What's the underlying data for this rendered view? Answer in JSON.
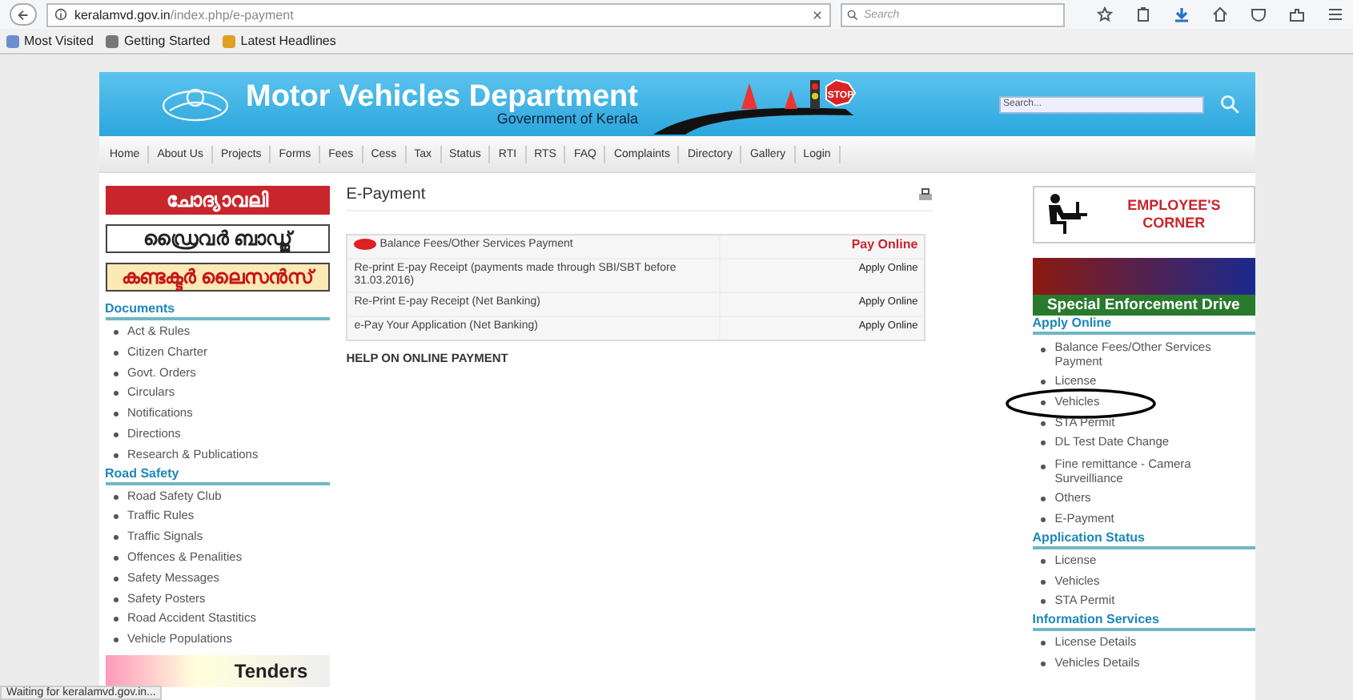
{
  "browser": {
    "url_domain": "keralamvd.gov.in",
    "url_path": "/index.php/e-payment",
    "search_placeholder": "Search",
    "bookmarks": [
      {
        "label": "Most Visited",
        "kind": "visited"
      },
      {
        "label": "Getting Started",
        "kind": "firefox"
      },
      {
        "label": "Latest Headlines",
        "kind": "feed"
      }
    ]
  },
  "header": {
    "title": "Motor Vehicles Department",
    "subtitle": "Government of Kerala",
    "sign": "STOP",
    "search_placeholder": "Search..."
  },
  "nav": [
    {
      "label": "Home"
    },
    {
      "label": "About Us"
    },
    {
      "label": "Projects"
    },
    {
      "label": "Forms"
    },
    {
      "label": "Fees"
    },
    {
      "label": "Cess"
    },
    {
      "label": "Tax"
    },
    {
      "label": "Status"
    },
    {
      "label": "RTI"
    },
    {
      "label": "RTS"
    },
    {
      "label": "FAQ"
    },
    {
      "label": "Complaints"
    },
    {
      "label": "Directory"
    },
    {
      "label": "Gallery"
    },
    {
      "label": "Login"
    }
  ],
  "left": {
    "banners": [
      {
        "text": "ചോദ്യാവലി",
        "kind": "red"
      },
      {
        "text": "ഡ്രൈവർ ബാഡ്ജ്",
        "kind": "plain"
      },
      {
        "text": "കണ്ടക്ടർ ലൈസൻസ്",
        "kind": "gold"
      }
    ],
    "sections": [
      {
        "title": "Documents",
        "items": [
          "Act & Rules",
          "Citizen Charter",
          "Govt. Orders",
          "Circulars",
          "Notifications",
          "Directions",
          "Research & Publications"
        ]
      },
      {
        "title": "Road Safety",
        "items": [
          "Road Safety Club",
          "Traffic Rules",
          "Traffic Signals",
          "Offences & Penalities",
          "Safety Messages",
          "Safety Posters",
          "Road Accident Stastitics",
          "Vehicle Populations"
        ]
      }
    ],
    "tenders": "Tenders"
  },
  "main": {
    "title": "E-Payment",
    "rows": [
      {
        "label": "Balance Fees/Other Services Payment",
        "action": "Pay Online",
        "kind": "primary",
        "new": true
      },
      {
        "label": "Re-print E-pay Receipt (payments made through SBI/SBT  before 31.03.2016)",
        "action": "Apply Online",
        "kind": "apply",
        "new": false
      },
      {
        "label": "Re-Print E-pay Receipt (Net Banking)",
        "action": "Apply Online",
        "kind": "apply",
        "new": false
      },
      {
        "label": "e-Pay Your Application (Net Banking)",
        "action": "Apply Online",
        "kind": "apply",
        "new": false
      }
    ],
    "help": "HELP ON ONLINE PAYMENT"
  },
  "right": {
    "employee_corner": [
      "EMPLOYEE'S",
      "CORNER"
    ],
    "enforcement": "Special Enforcement Drive",
    "sections": [
      {
        "title": "Apply Online",
        "items": [
          {
            "label": "Balance Fees/Other Services Payment",
            "circled": false
          },
          {
            "label": "License",
            "circled": false
          },
          {
            "label": "Vehicles",
            "circled": true
          },
          {
            "label": "STA Permit",
            "circled": false
          },
          {
            "label": "DL Test Date Change",
            "circled": false
          },
          {
            "label": "Fine remittance - Camera Surveilliance",
            "circled": false
          },
          {
            "label": "Others",
            "circled": false
          },
          {
            "label": "E-Payment",
            "circled": false
          }
        ]
      },
      {
        "title": "Application Status",
        "items": [
          {
            "label": "License",
            "circled": false
          },
          {
            "label": "Vehicles",
            "circled": false
          },
          {
            "label": "STA Permit",
            "circled": false
          }
        ]
      },
      {
        "title": "Information Services",
        "items": [
          {
            "label": "License Details",
            "circled": false
          },
          {
            "label": "Vehicles Details",
            "circled": false
          }
        ]
      }
    ]
  },
  "status_bar": "Waiting for keralamvd.gov.in..."
}
